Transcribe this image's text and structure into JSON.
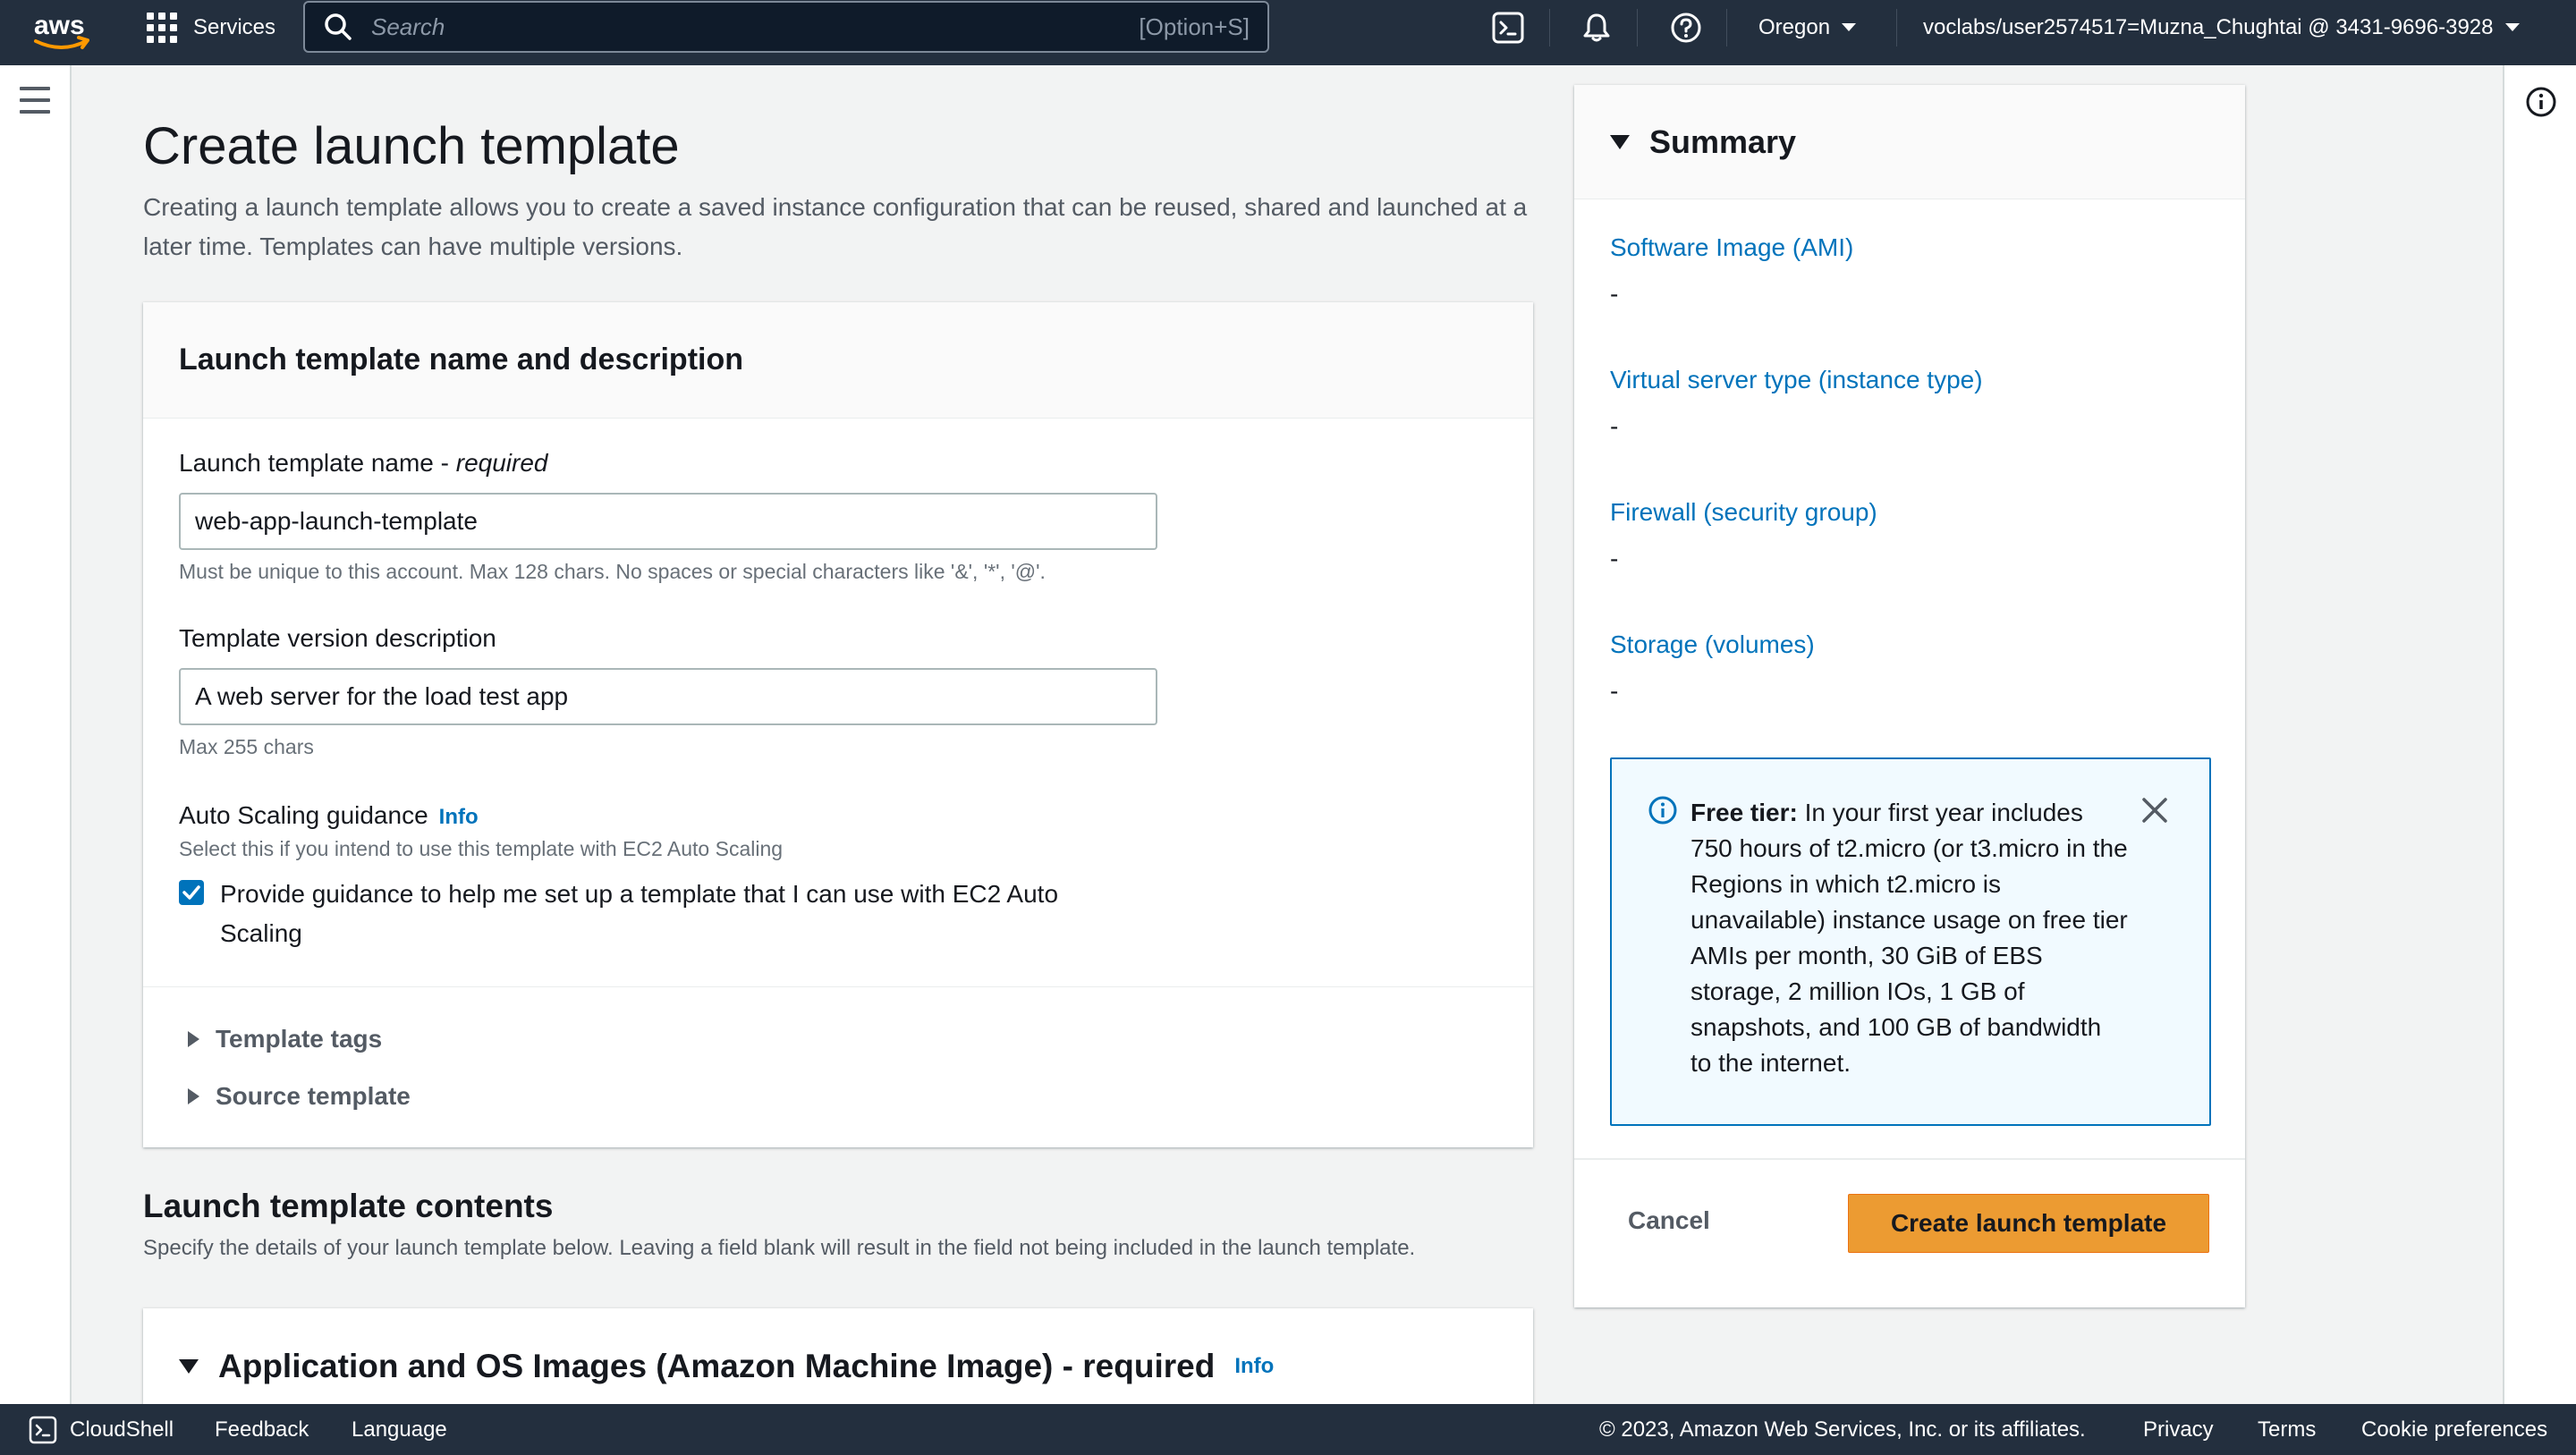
{
  "topnav": {
    "logo_text": "aws",
    "services_label": "Services",
    "search_placeholder": "Search",
    "search_shortcut": "[Option+S]",
    "region": "Oregon",
    "account": "voclabs/user2574517=Muzna_Chughtai @ 3431-9696-3928"
  },
  "page": {
    "title": "Create launch template",
    "description": "Creating a launch template allows you to create a saved instance configuration that can be reused, shared and launched at a later time. Templates can have multiple versions."
  },
  "name_section": {
    "heading": "Launch template name and description",
    "name_label": "Launch template name - ",
    "name_required": "required",
    "name_value": "web-app-launch-template",
    "name_hint": "Must be unique to this account. Max 128 chars. No spaces or special characters like '&', '*', '@'.",
    "desc_label": "Template version description",
    "desc_value": "A web server for the load test app",
    "desc_hint": "Max 255 chars",
    "autoscaling_label": "Auto Scaling guidance",
    "autoscaling_info": "Info",
    "autoscaling_hint": "Select this if you intend to use this template with EC2 Auto Scaling",
    "autoscaling_checkbox_label": "Provide guidance to help me set up a template that I can use with EC2 Auto Scaling",
    "autoscaling_checked": true,
    "template_tags": "Template tags",
    "source_template": "Source template"
  },
  "contents": {
    "title": "Launch template contents",
    "description": "Specify the details of your launch template below. Leaving a field blank will result in the field not being included in the launch template.",
    "ami_heading": "Application and OS Images (Amazon Machine Image) - required",
    "ami_info": "Info"
  },
  "summary": {
    "heading": "Summary",
    "items": [
      {
        "label": "Software Image (AMI)",
        "value": "-"
      },
      {
        "label": "Virtual server type (instance type)",
        "value": "-"
      },
      {
        "label": "Firewall (security group)",
        "value": "-"
      },
      {
        "label": "Storage (volumes)",
        "value": "-"
      }
    ],
    "free_tier_bold": "Free tier:",
    "free_tier_text": " In your first year includes 750 hours of t2.micro (or t3.micro in the Regions in which t2.micro is unavailable) instance usage on free tier AMIs per month, 30 GiB of EBS storage, 2 million IOs, 1 GB of snapshots, and 100 GB of bandwidth to the internet.",
    "cancel_label": "Cancel",
    "create_label": "Create launch template"
  },
  "footer": {
    "cloudshell": "CloudShell",
    "feedback": "Feedback",
    "language": "Language",
    "copyright": "© 2023, Amazon Web Services, Inc. or its affiliates.",
    "privacy": "Privacy",
    "terms": "Terms",
    "cookie": "Cookie preferences"
  },
  "colors": {
    "nav_bg": "#232f3e",
    "link_blue": "#0073bb",
    "primary_orange": "#ec9b32",
    "page_bg": "#f2f3f3"
  }
}
